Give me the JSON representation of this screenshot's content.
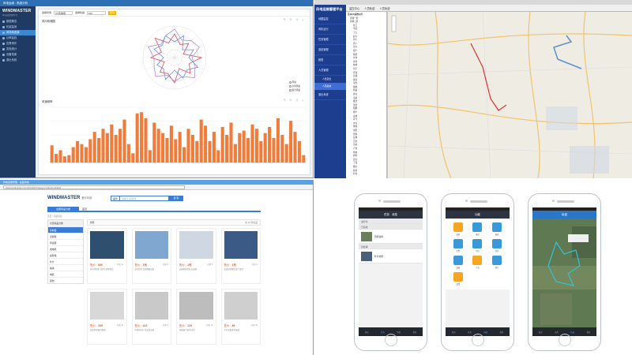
{
  "dashboard": {
    "window_title": "风电运维 - 机组分析",
    "logo": "WINDMASTER",
    "logo_sub": "风电运维管理平台",
    "nav": [
      "数据概览",
      "机组监测",
      "风场风资源",
      "功率曲线",
      "告警事件",
      "发电统计",
      "设备档案",
      "退出系统"
    ],
    "active_nav_index": 2,
    "filters": {
      "label1": "选择风场",
      "value1": "XX风电场",
      "label2": "选择机组",
      "value2": "#01",
      "query": "查询"
    },
    "section1": "风向玫瑰图",
    "section2": "风速频率",
    "tool_icons": "✎ ↻ ⎙ ⤓",
    "rose_legend": [
      "风频",
      "平均风速",
      "最大风速"
    ],
    "bar_legend": "风频",
    "accent": "#f07c3c",
    "chart_data": {
      "type": "bar",
      "title": "",
      "xlabel": "",
      "ylabel": "",
      "ylim": [
        0,
        90
      ],
      "values": [
        28,
        14,
        20,
        10,
        12,
        25,
        35,
        30,
        25,
        38,
        50,
        40,
        55,
        48,
        62,
        45,
        55,
        70,
        30,
        15,
        80,
        82,
        72,
        20,
        65,
        55,
        48,
        40,
        60,
        38,
        50,
        25,
        55,
        45,
        35,
        70,
        60,
        35,
        50,
        20,
        58,
        45,
        65,
        30,
        48,
        52,
        40,
        62,
        55,
        35,
        48,
        58,
        40,
        72,
        45,
        30,
        68,
        50,
        35,
        12
      ]
    }
  },
  "map_app": {
    "logo": "风电运维管理平台",
    "menu": [
      "地图监控",
      "风机运行",
      "任务管理",
      "巡检管理",
      "报表",
      "人员管理",
      "退出系统"
    ],
    "submenu": [
      "人员定位",
      "人员轨迹"
    ],
    "toolbar": [
      "监控中心",
      "人员轨迹",
      "人员轨迹"
    ],
    "tree_root": "苏州XX运维公司",
    "tree_items": [
      "风场一区",
      "风场二区",
      "张三",
      "李四",
      "王五",
      "赵六",
      "孙七",
      "周八",
      "吴九",
      "郑十",
      "陈明",
      "刘洋",
      "黄伟",
      "林峰",
      "何军",
      "罗强",
      "高翔",
      "梁涛",
      "宋杰",
      "谢斌",
      "韩磊",
      "唐亮",
      "冯超",
      "董浩",
      "萧然",
      "程鹏",
      "曹宇",
      "袁帅",
      "邓飞",
      "许可",
      "傅强",
      "沈阳",
      "曾辉",
      "彭博",
      "吕杰",
      "苏航",
      "卢伟",
      "蒋峰",
      "蔡明",
      "贾亮",
      "丁强",
      "魏东",
      "薛松",
      "叶青"
    ],
    "route_color": "#d9342b"
  },
  "store": {
    "browser_title": "风电运维管理 - 设备商城",
    "url": "www.windmaster.com/store/list?category=1&sort=default",
    "logo": "WINDMASTER",
    "logo_cn": "备件商城",
    "search_tag": "备件",
    "search_placeholder": "请输入关键词",
    "search_btn": "搜 索",
    "tabs": [
      "全部商品分类",
      "首页"
    ],
    "crumb": "首页 > 商品列表",
    "cats_header": "全部商品分类",
    "cats": [
      "控制器",
      "变频器",
      "传感器",
      "发电机",
      "齿轮箱",
      "叶片",
      "轴承",
      "电缆",
      "其他"
    ],
    "sort_label": "排序",
    "sort_right": "共 12 件商品",
    "products": [
      {
        "price": "售价：",
        "amt": "899",
        "sales": "已售 12",
        "desc": "风电控制柜 适用于多种机型"
      },
      {
        "price": "售价：",
        "amt": "1元",
        "sales": "已售 8",
        "desc": "监控软件 远程数据采集"
      },
      {
        "price": "售价：",
        "amt": "1元",
        "sales": "已售 5",
        "desc": "运维管理系统 标准版"
      },
      {
        "price": "售价：",
        "amt": "1元",
        "sales": "已售 3",
        "desc": "变桨控制模块 原厂配件"
      },
      {
        "price": "售价：",
        "amt": "259",
        "sales": "已售 21",
        "desc": "温度传感器 高精度"
      },
      {
        "price": "售价：",
        "amt": "419",
        "sales": "已售 9",
        "desc": "风速风向仪 带安装支架"
      },
      {
        "price": "售价：",
        "amt": "129",
        "sales": "已售 14",
        "desc": "接线端子盒 防水型"
      },
      {
        "price": "售价：",
        "amt": "89",
        "sales": "已售 30",
        "desc": "信号采集器 四通道"
      }
    ],
    "price_color": "#e05020"
  },
  "phones": [
    {
      "title": "任务",
      "tab2": "消息",
      "section1": "进行中",
      "section2": "已完成",
      "section3": "待处理",
      "item1": "风机巡检",
      "item2": "叶片检修",
      "tabs": [
        "首页",
        "任务",
        "消息",
        "我的"
      ],
      "active_tab": 1
    },
    {
      "title": "功能",
      "tiles": [
        "巡检",
        "维修",
        "报表",
        "告警",
        "定位",
        "任务",
        "设备",
        "人员",
        "统计",
        "设置"
      ],
      "tabs": [
        "首页",
        "任务",
        "功能",
        "我的"
      ],
      "active_tab": 2
    },
    {
      "title": "轨迹",
      "tabs": [
        "首页",
        "任务",
        "轨迹",
        "我的"
      ],
      "active_tab": 2
    }
  ]
}
